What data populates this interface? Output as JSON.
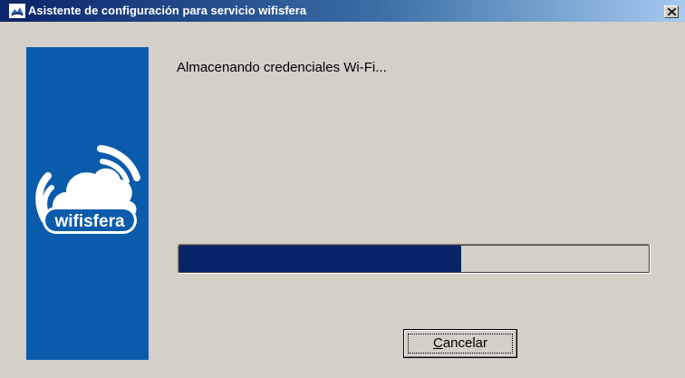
{
  "window": {
    "title": "Asistente de configuración para servicio wifisfera",
    "close_symbol": "×"
  },
  "sidebar": {
    "logo_text": "wifisfera",
    "logo_icon": "cloud-wifi-logo",
    "background_color": "#0a5bab"
  },
  "main": {
    "status_text": "Almacenando credenciales Wi-Fi...",
    "progress_percent": 60,
    "progress_color": "#0a246a"
  },
  "buttons": {
    "cancel_mnemonic": "C",
    "cancel_rest": "ancelar"
  }
}
